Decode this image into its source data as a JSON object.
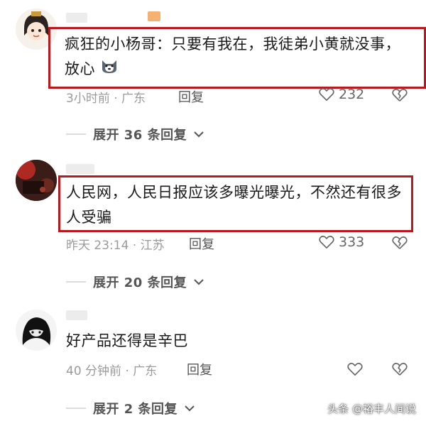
{
  "comments": [
    {
      "text": "疯狂的小杨哥：只要有我在，我徒弟小黄就没事，放心",
      "time_location": "3小时前 · 广东",
      "reply_label": "回复",
      "likes": "232",
      "expand_label": "展开 36 条回复",
      "highlighted": true
    },
    {
      "text": "人民网，人民日报应该多曝光曝光，不然还有很多人受骗",
      "time_location": "昨天 23:14 · 江苏",
      "reply_label": "回复",
      "likes": "333",
      "expand_label": "展开 20 条回复",
      "highlighted": true
    },
    {
      "text": "好产品还得是辛巴",
      "time_location": "40 分钟前 · 广东",
      "reply_label": "回复",
      "likes": "",
      "expand_label": "展开 2 条回复",
      "highlighted": false
    }
  ],
  "watermark": "头条 @裕丰人间说",
  "colors": {
    "highlight_border": "#b8191f",
    "meta": "#9a9a9a"
  },
  "icons": [
    "avatar",
    "dog-emoji-icon",
    "heart-icon",
    "broken-heart-icon",
    "chevron-down-icon"
  ]
}
